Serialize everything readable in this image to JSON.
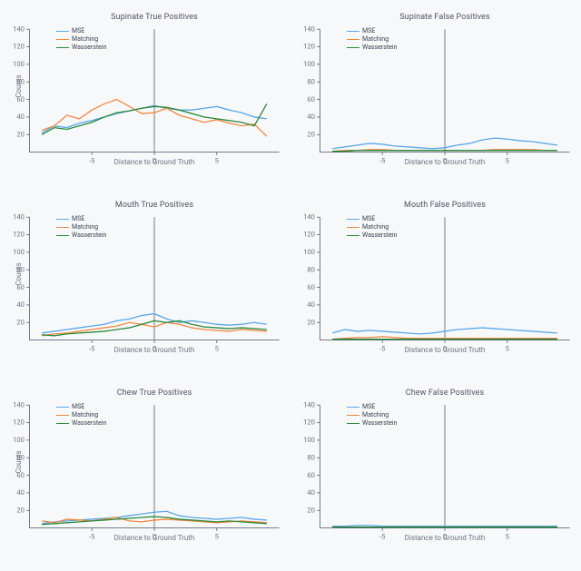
{
  "colors": {
    "MSE": "#5aa7e8",
    "Matching": "#f0883e",
    "Wasserstein": "#2b8a3e"
  },
  "chart_data": [
    {
      "title": "Supinate True Positives",
      "type": "line",
      "xlabel": "Distance to Ground Truth",
      "ylabel": "Counts",
      "x": [
        -9,
        -8,
        -7,
        -6,
        -5,
        -4,
        -3,
        -2,
        -1,
        0,
        1,
        2,
        3,
        4,
        5,
        6,
        7,
        8,
        9
      ],
      "ylim": [
        0,
        140
      ],
      "xlim": [
        -10,
        10
      ],
      "yticks": [
        20,
        40,
        60,
        80,
        100,
        120,
        140
      ],
      "xticks": [
        -5,
        0,
        5
      ],
      "legend": [
        "MSE",
        "Matching",
        "Wasserstein"
      ],
      "series": [
        {
          "name": "MSE",
          "values": [
            22,
            30,
            28,
            33,
            36,
            40,
            44,
            47,
            50,
            53,
            50,
            48,
            48,
            50,
            52,
            48,
            45,
            40,
            38
          ]
        },
        {
          "name": "Matching",
          "values": [
            25,
            30,
            42,
            38,
            48,
            55,
            60,
            52,
            44,
            45,
            50,
            42,
            38,
            34,
            37,
            33,
            30,
            32,
            18
          ]
        },
        {
          "name": "Wasserstein",
          "values": [
            20,
            28,
            26,
            30,
            34,
            40,
            45,
            47,
            50,
            52,
            51,
            48,
            44,
            40,
            38,
            36,
            34,
            30,
            55
          ]
        }
      ]
    },
    {
      "title": "Supinate False Positives",
      "type": "line",
      "xlabel": "Distance to Ground Truth",
      "ylabel": "",
      "x": [
        -9,
        -8,
        -7,
        -6,
        -5,
        -4,
        -3,
        -2,
        -1,
        0,
        1,
        2,
        3,
        4,
        5,
        6,
        7,
        8,
        9
      ],
      "ylim": [
        0,
        140
      ],
      "xlim": [
        -10,
        10
      ],
      "yticks": [
        20,
        40,
        60,
        80,
        100,
        120,
        140
      ],
      "xticks": [
        -5,
        0,
        5
      ],
      "legend": [
        "MSE",
        "Matching",
        "Wasserstein"
      ],
      "series": [
        {
          "name": "MSE",
          "values": [
            4,
            6,
            8,
            10,
            9,
            7,
            6,
            5,
            4,
            5,
            8,
            10,
            14,
            16,
            15,
            13,
            12,
            10,
            8
          ]
        },
        {
          "name": "Matching",
          "values": [
            1,
            2,
            2,
            3,
            3,
            2,
            2,
            2,
            2,
            2,
            2,
            2,
            2,
            3,
            3,
            3,
            3,
            2,
            2
          ]
        },
        {
          "name": "Wasserstein",
          "values": [
            1,
            1,
            2,
            2,
            2,
            2,
            2,
            2,
            2,
            2,
            2,
            2,
            2,
            2,
            2,
            2,
            2,
            2,
            2
          ]
        }
      ]
    },
    {
      "title": "Mouth True Positives",
      "type": "line",
      "xlabel": "Distance to Ground Truth",
      "ylabel": "Counts",
      "x": [
        -9,
        -8,
        -7,
        -6,
        -5,
        -4,
        -3,
        -2,
        -1,
        0,
        1,
        2,
        3,
        4,
        5,
        6,
        7,
        8,
        9
      ],
      "ylim": [
        0,
        140
      ],
      "xlim": [
        -10,
        10
      ],
      "yticks": [
        20,
        40,
        60,
        80,
        100,
        120,
        140
      ],
      "xticks": [
        -5,
        0,
        5
      ],
      "legend": [
        "MSE",
        "Matching",
        "Wasserstein"
      ],
      "series": [
        {
          "name": "MSE",
          "values": [
            8,
            10,
            12,
            14,
            16,
            18,
            22,
            24,
            28,
            30,
            24,
            20,
            22,
            20,
            18,
            17,
            18,
            20,
            18
          ]
        },
        {
          "name": "Matching",
          "values": [
            5,
            7,
            8,
            10,
            12,
            14,
            16,
            20,
            18,
            15,
            20,
            18,
            14,
            12,
            11,
            10,
            12,
            11,
            10
          ]
        },
        {
          "name": "Wasserstein",
          "values": [
            6,
            5,
            7,
            8,
            9,
            10,
            12,
            14,
            18,
            22,
            20,
            22,
            18,
            15,
            14,
            13,
            14,
            13,
            12
          ]
        }
      ]
    },
    {
      "title": "Mouth False Positives",
      "type": "line",
      "xlabel": "Distance to Ground Truth",
      "ylabel": "",
      "x": [
        -9,
        -8,
        -7,
        -6,
        -5,
        -4,
        -3,
        -2,
        -1,
        0,
        1,
        2,
        3,
        4,
        5,
        6,
        7,
        8,
        9
      ],
      "ylim": [
        0,
        140
      ],
      "xlim": [
        -10,
        10
      ],
      "yticks": [
        20,
        40,
        60,
        80,
        100,
        120,
        140
      ],
      "xticks": [
        -5,
        0,
        5
      ],
      "legend": [
        "MSE",
        "Matching",
        "Wasserstein"
      ],
      "series": [
        {
          "name": "MSE",
          "values": [
            8,
            12,
            10,
            11,
            10,
            9,
            8,
            7,
            8,
            10,
            12,
            13,
            14,
            13,
            12,
            11,
            10,
            9,
            8
          ]
        },
        {
          "name": "Matching",
          "values": [
            1,
            2,
            3,
            3,
            4,
            3,
            2,
            2,
            2,
            2,
            2,
            2,
            2,
            2,
            2,
            2,
            2,
            2,
            2
          ]
        },
        {
          "name": "Wasserstein",
          "values": [
            1,
            1,
            1,
            1,
            1,
            1,
            1,
            1,
            1,
            1,
            1,
            1,
            1,
            1,
            1,
            1,
            1,
            1,
            1
          ]
        }
      ]
    },
    {
      "title": "Chew True Positives",
      "type": "line",
      "xlabel": "Distance to Ground Truth",
      "ylabel": "Counts",
      "x": [
        -9,
        -8,
        -7,
        -6,
        -5,
        -4,
        -3,
        -2,
        -1,
        0,
        1,
        2,
        3,
        4,
        5,
        6,
        7,
        8,
        9
      ],
      "ylim": [
        0,
        140
      ],
      "xlim": [
        -10,
        10
      ],
      "yticks": [
        20,
        40,
        60,
        80,
        100,
        120,
        140
      ],
      "xticks": [
        -5,
        0,
        5
      ],
      "legend": [
        "MSE",
        "Matching",
        "Wasserstein"
      ],
      "series": [
        {
          "name": "MSE",
          "values": [
            5,
            7,
            8,
            9,
            10,
            11,
            12,
            14,
            16,
            18,
            19,
            14,
            12,
            11,
            10,
            11,
            12,
            10,
            9
          ]
        },
        {
          "name": "Matching",
          "values": [
            8,
            6,
            10,
            9,
            8,
            10,
            12,
            8,
            7,
            9,
            10,
            9,
            8,
            7,
            6,
            7,
            8,
            7,
            6
          ]
        },
        {
          "name": "Wasserstein",
          "values": [
            4,
            5,
            6,
            7,
            8,
            9,
            10,
            11,
            12,
            13,
            12,
            10,
            9,
            8,
            7,
            8,
            7,
            6,
            5
          ]
        }
      ]
    },
    {
      "title": "Chew False Positives",
      "type": "line",
      "xlabel": "Distance to Ground Truth",
      "ylabel": "",
      "x": [
        -9,
        -8,
        -7,
        -6,
        -5,
        -4,
        -3,
        -2,
        -1,
        0,
        1,
        2,
        3,
        4,
        5,
        6,
        7,
        8,
        9
      ],
      "ylim": [
        0,
        140
      ],
      "xlim": [
        -10,
        10
      ],
      "yticks": [
        20,
        40,
        60,
        80,
        100,
        120,
        140
      ],
      "xticks": [
        -5,
        0,
        5
      ],
      "legend": [
        "MSE",
        "Matching",
        "Wasserstein"
      ],
      "series": [
        {
          "name": "MSE",
          "values": [
            2,
            2,
            3,
            3,
            2,
            2,
            2,
            2,
            2,
            2,
            2,
            2,
            2,
            2,
            2,
            2,
            2,
            2,
            2
          ]
        },
        {
          "name": "Matching",
          "values": [
            1,
            1,
            1,
            1,
            1,
            1,
            1,
            1,
            1,
            1,
            1,
            1,
            1,
            1,
            1,
            1,
            1,
            1,
            1
          ]
        },
        {
          "name": "Wasserstein",
          "values": [
            1,
            1,
            1,
            1,
            1,
            1,
            1,
            1,
            1,
            1,
            1,
            1,
            1,
            1,
            1,
            1,
            1,
            1,
            1
          ]
        }
      ]
    }
  ]
}
